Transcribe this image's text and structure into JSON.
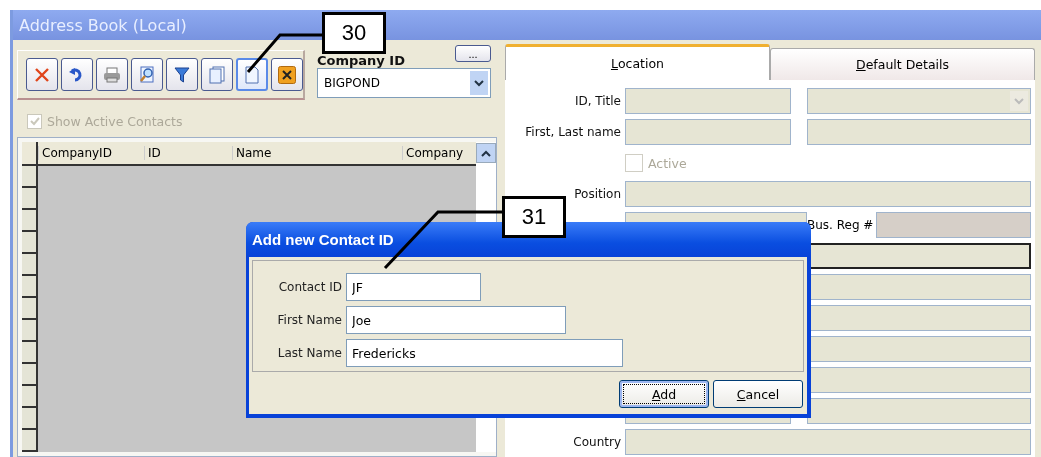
{
  "window": {
    "title": "Address Book (Local)"
  },
  "toolbar": {
    "buttons": [
      {
        "kind": "delete",
        "selected": false
      },
      {
        "kind": "undo",
        "selected": false
      },
      {
        "kind": "print",
        "selected": false
      },
      {
        "kind": "preview",
        "selected": false
      },
      {
        "kind": "filter",
        "selected": false
      },
      {
        "kind": "copy",
        "selected": false
      },
      {
        "kind": "new",
        "selected": true
      },
      {
        "kind": "close",
        "selected": false
      }
    ]
  },
  "company": {
    "label": "Company ID",
    "more_button": "...",
    "value": "BIGPOND"
  },
  "show_active": {
    "label": "Show Active Contacts",
    "checked": true,
    "disabled": true
  },
  "table": {
    "columns": [
      "CompanyID",
      "ID",
      "Name",
      "Company"
    ]
  },
  "tabs": [
    {
      "label": "Location",
      "selected": true
    },
    {
      "label": "Default Details",
      "selected": false
    }
  ],
  "form": {
    "rows": [
      {
        "kind": "two",
        "label": "ID, Title",
        "dropdown": true
      },
      {
        "kind": "two",
        "label": "First, Last name",
        "dropdown": false
      },
      {
        "kind": "check",
        "label": "Active",
        "checked": false,
        "disabled": true
      },
      {
        "kind": "one",
        "label": "Position",
        "focused": false
      },
      {
        "kind": "reg",
        "side_label": "Bus. Reg #"
      },
      {
        "kind": "one",
        "focused": true
      },
      {
        "kind": "one",
        "focused": false
      },
      {
        "kind": "one",
        "focused": false
      },
      {
        "kind": "one",
        "focused": false
      },
      {
        "kind": "one",
        "focused": false
      },
      {
        "kind": "two",
        "dropdown": false
      },
      {
        "kind": "one",
        "label": "Country",
        "focused": false
      }
    ]
  },
  "dialog": {
    "title": "Add new Contact ID",
    "fields": [
      {
        "label": "Contact ID",
        "value": "JF"
      },
      {
        "label": "First Name",
        "value": "Joe"
      },
      {
        "label": "Last Name",
        "value": "Fredericks"
      }
    ],
    "buttons": [
      {
        "label": "Add",
        "default": true
      },
      {
        "label": "Cancel",
        "default": false
      }
    ]
  },
  "callouts": [
    {
      "number": "30"
    },
    {
      "number": "31"
    }
  ]
}
